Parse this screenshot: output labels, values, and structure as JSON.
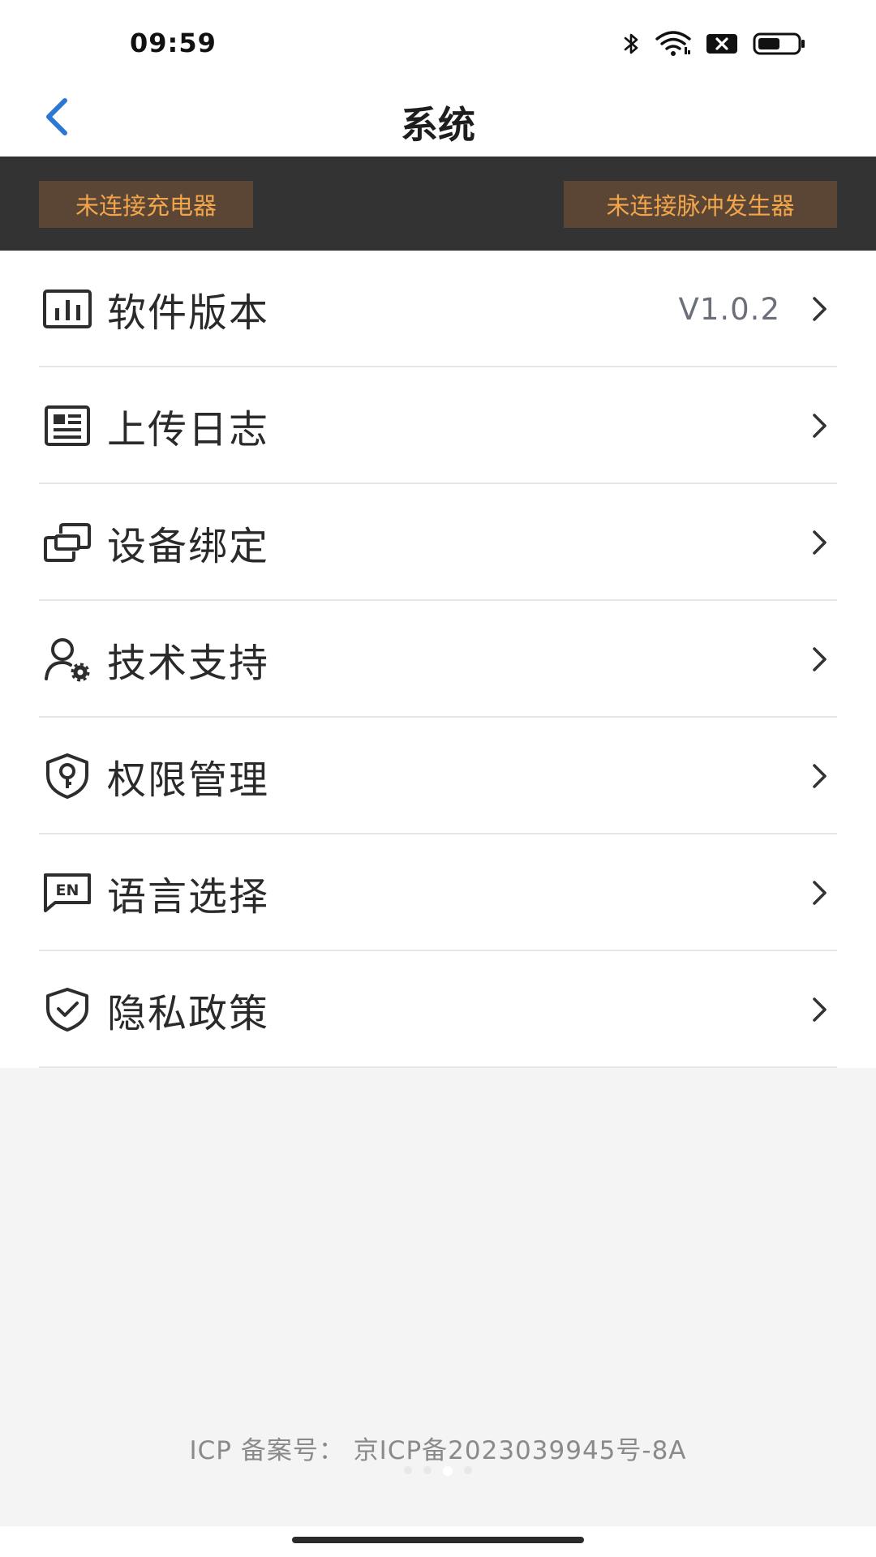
{
  "status": {
    "time": "09:59",
    "icons": [
      "bluetooth-icon",
      "wifi-icon",
      "sim-off-icon",
      "battery-icon"
    ]
  },
  "nav": {
    "title": "系统",
    "back_icon": "chevron-left-icon",
    "accent_color": "#2a78d4"
  },
  "connection": {
    "charger": "未连接充电器",
    "pulse_generator": "未连接脉冲发生器",
    "badge_text_color": "#f2a54a"
  },
  "menu": {
    "items": [
      {
        "label": "软件版本",
        "value": "V1.0.2",
        "icon": "chart-icon"
      },
      {
        "label": "上传日志",
        "icon": "log-icon"
      },
      {
        "label": "设备绑定",
        "icon": "link-icon"
      },
      {
        "label": "技术支持",
        "icon": "support-user-icon"
      },
      {
        "label": "权限管理",
        "icon": "permission-shield-icon"
      },
      {
        "label": "语言选择",
        "icon": "language-en-icon"
      },
      {
        "label": "隐私政策",
        "icon": "privacy-shield-icon"
      }
    ]
  },
  "footer": {
    "icp": "ICP 备案号： 京ICP备2023039945号-8A"
  }
}
